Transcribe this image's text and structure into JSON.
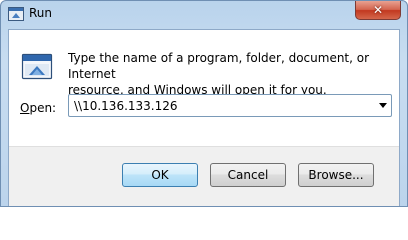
{
  "window": {
    "title": "Run",
    "close_glyph": "✕"
  },
  "dialog": {
    "description": "Type the name of a program, folder, document, or Internet\nresource, and Windows will open it for you.",
    "open_label_accel": "O",
    "open_label_rest": "pen:",
    "open_value": "\\\\10.136.133.126"
  },
  "buttons": {
    "ok": "OK",
    "cancel": "Cancel",
    "browse": "Browse..."
  },
  "icons": {
    "title": "run-icon",
    "main": "run-icon",
    "close": "close-icon",
    "dropdown": "chevron-down-icon"
  },
  "colors": {
    "title_bar": "#bcd4ec",
    "close_button": "#c2381f",
    "default_button_border": "#3c7fb1"
  }
}
